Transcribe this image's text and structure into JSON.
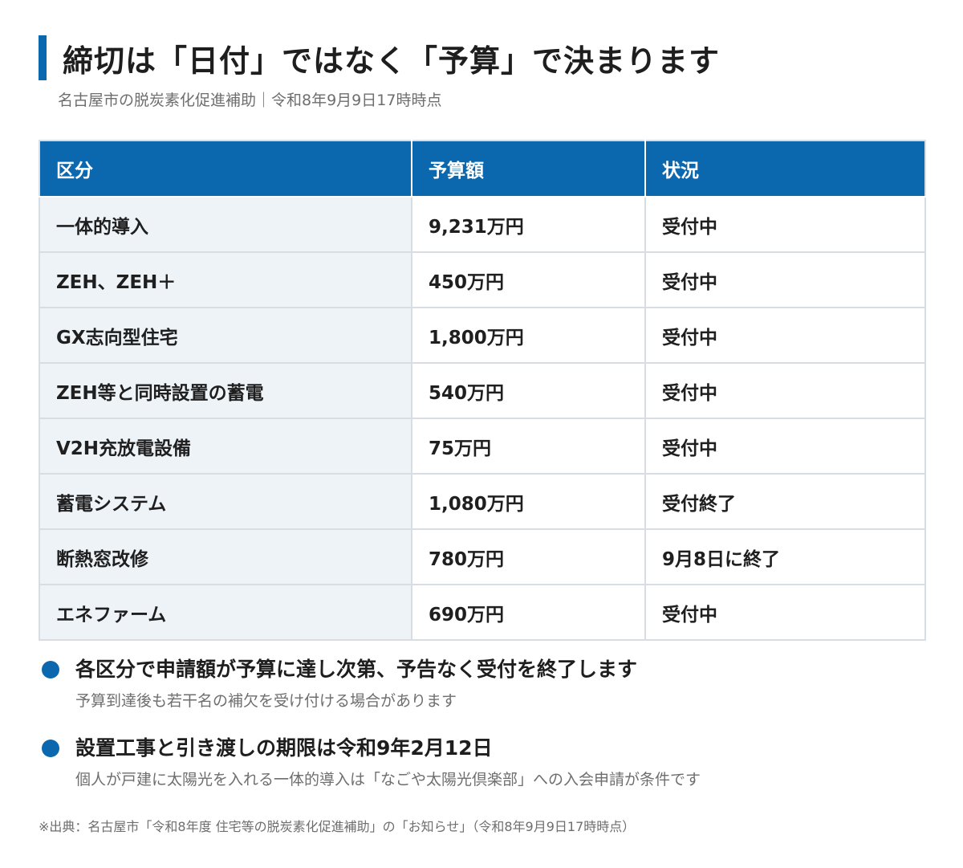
{
  "title": "締切は「日付」ではなく「予算」で決まります",
  "subtitle": "名古屋市の脱炭素化促進補助｜令和8年9月9日17時時点",
  "colors": {
    "accent": "#0c68ae",
    "category_bg": "#eef3f8",
    "border": "#d7dde3",
    "muted_text": "#6e6e6e"
  },
  "table": {
    "headers": [
      "区分",
      "予算額",
      "状況"
    ],
    "rows": [
      {
        "category": "一体的導入",
        "budget": "9,231万円",
        "status": "受付中"
      },
      {
        "category": "ZEH、ZEH＋",
        "budget": "450万円",
        "status": "受付中"
      },
      {
        "category": "GX志向型住宅",
        "budget": "1,800万円",
        "status": "受付中"
      },
      {
        "category": "ZEH等と同時設置の蓄電",
        "budget": "540万円",
        "status": "受付中"
      },
      {
        "category": "V2H充放電設備",
        "budget": "75万円",
        "status": "受付中"
      },
      {
        "category": "蓄電システム",
        "budget": "1,080万円",
        "status": "受付終了"
      },
      {
        "category": "断熱窓改修",
        "budget": "780万円",
        "status": "9月8日に終了"
      },
      {
        "category": "エネファーム",
        "budget": "690万円",
        "status": "受付中"
      }
    ]
  },
  "notes": [
    {
      "main": "各区分で申請額が予算に達し次第、予告なく受付を終了します",
      "sub": "予算到達後も若干名の補欠を受け付ける場合があります"
    },
    {
      "main": "設置工事と引き渡しの期限は令和9年2月12日",
      "sub": "個人が戸建に太陽光を入れる一体的導入は「なごや太陽光倶楽部」への入会申請が条件です"
    }
  ],
  "source": "※出典：名古屋市「令和8年度 住宅等の脱炭素化促進補助」の「お知らせ」（令和8年9月9日17時時点）",
  "icons": {
    "title_marker": "accent-bar",
    "note_marker": "bullet-dot-icon"
  }
}
